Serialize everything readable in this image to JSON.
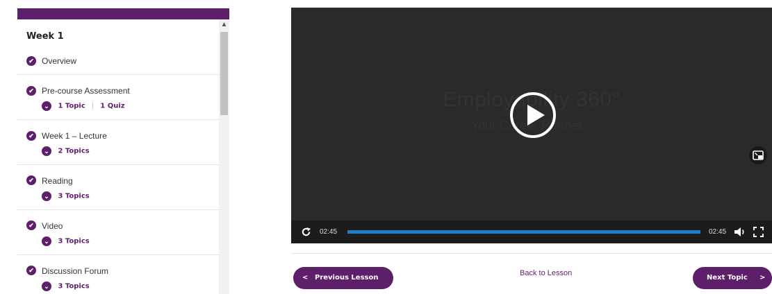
{
  "sidebar": {
    "week_title": "Week 1",
    "items": [
      {
        "label": "Overview",
        "completed": true,
        "meta": null
      },
      {
        "label": "Pre-course Assessment",
        "completed": true,
        "meta": {
          "topics": "1 Topic",
          "quiz": "1 Quiz"
        }
      },
      {
        "label": "Week 1 – Lecture",
        "completed": true,
        "meta": {
          "topics": "2 Topics"
        }
      },
      {
        "label": "Reading",
        "completed": true,
        "meta": {
          "topics": "3 Topics"
        }
      },
      {
        "label": "Video",
        "completed": true,
        "meta": {
          "topics": "3 Topics"
        }
      },
      {
        "label": "Discussion Forum",
        "completed": true,
        "meta": {
          "topics": "3 Topics"
        }
      }
    ]
  },
  "video": {
    "background_title": "Employability 360°",
    "background_subtitle": "Your Career Partner...",
    "elapsed_time": "02:45",
    "total_time": "02:45",
    "progress_fraction": 1.0
  },
  "navigation": {
    "previous_label": "Previous Lesson",
    "back_label": "Back to Lesson",
    "next_label": "Next Topic"
  },
  "colors": {
    "brand_purple": "#5e1f6a",
    "progress_blue": "#1b7ec7",
    "video_bg": "#2a2a2a"
  },
  "icons": [
    "check-circle-icon",
    "chevron-down-icon",
    "play-icon",
    "replay-icon",
    "volume-icon",
    "fullscreen-icon",
    "picture-in-picture-icon",
    "chevron-left-icon",
    "chevron-right-icon"
  ]
}
